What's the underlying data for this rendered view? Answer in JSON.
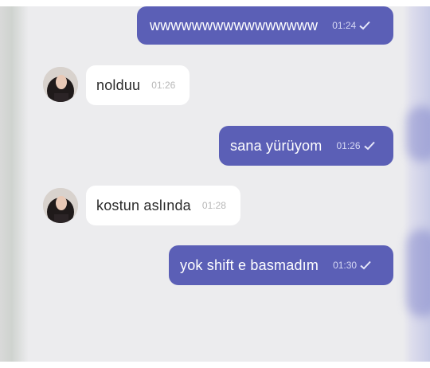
{
  "chat": {
    "messages": [
      {
        "direction": "outgoing",
        "text": "wwwwwwwwwwwwwwww",
        "time": "01:24",
        "status": "read-check"
      },
      {
        "direction": "incoming",
        "text": "nolduu",
        "time": "01:26"
      },
      {
        "direction": "outgoing",
        "text": "sana yürüyom",
        "time": "01:26",
        "status": "read-check"
      },
      {
        "direction": "incoming",
        "text": "kostun aslında",
        "time": "01:28"
      },
      {
        "direction": "outgoing",
        "text": "yok shift e basmadım",
        "time": "01:30",
        "status": "read-check"
      }
    ]
  },
  "colors": {
    "outgoing_bubble": "#5b5fb6",
    "incoming_bubble": "#ffffff",
    "background": "#ececee"
  },
  "icons": {
    "check": "check-icon",
    "avatar": "contact-avatar"
  }
}
